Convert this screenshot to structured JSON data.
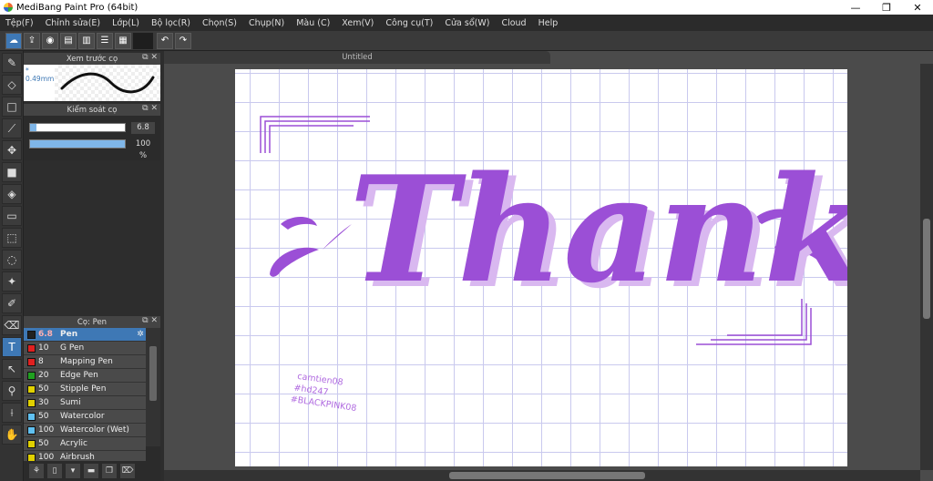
{
  "window": {
    "title": "MediBang Paint Pro (64bit)",
    "minimize": "—",
    "restore": "❐",
    "close": "✕"
  },
  "menu": [
    "Tệp(F)",
    "Chỉnh sửa(E)",
    "Lớp(L)",
    "Bộ lọc(R)",
    "Chọn(S)",
    "Chụp(N)",
    "Màu (C)",
    "Xem(V)",
    "Công cụ(T)",
    "Cửa sổ(W)",
    "Cloud",
    "Help"
  ],
  "toolbar": {
    "undo": "↶",
    "redo": "↷"
  },
  "panels": {
    "preview": {
      "title": "Xem trước cọ",
      "size": "* 0.49mm"
    },
    "control": {
      "title": "Kiểm soát cọ",
      "size_value": "6.8",
      "size_fraction": 0.07,
      "opacity_value": "100 %",
      "opacity_fraction": 1.0
    },
    "brushes": {
      "title": "Cọ: Pen",
      "items": [
        {
          "size": "6.8",
          "name": "Pen",
          "color": "#222222",
          "selected": true
        },
        {
          "size": "10",
          "name": "G Pen",
          "color": "#e02020"
        },
        {
          "size": "8",
          "name": "Mapping Pen",
          "color": "#e02020"
        },
        {
          "size": "20",
          "name": "Edge Pen",
          "color": "#20a020"
        },
        {
          "size": "50",
          "name": "Stipple Pen",
          "color": "#e0d000"
        },
        {
          "size": "30",
          "name": "Sumi",
          "color": "#e0d000"
        },
        {
          "size": "50",
          "name": "Watercolor",
          "color": "#60c0f0"
        },
        {
          "size": "100",
          "name": "Watercolor (Wet)",
          "color": "#60c0f0"
        },
        {
          "size": "50",
          "name": "Acrylic",
          "color": "#e0d000"
        },
        {
          "size": "100",
          "name": "Airbrush",
          "color": "#e0d000"
        }
      ]
    }
  },
  "document": {
    "tab": "Untitled"
  },
  "artwork": {
    "main_text": "Thank",
    "main_color": "#9b4fd6",
    "shadow_color": "#d9b8f0",
    "signature": [
      "camtien08",
      "#hd247",
      "#BLACKPINK08"
    ],
    "signature_color": "#b06ae0"
  }
}
